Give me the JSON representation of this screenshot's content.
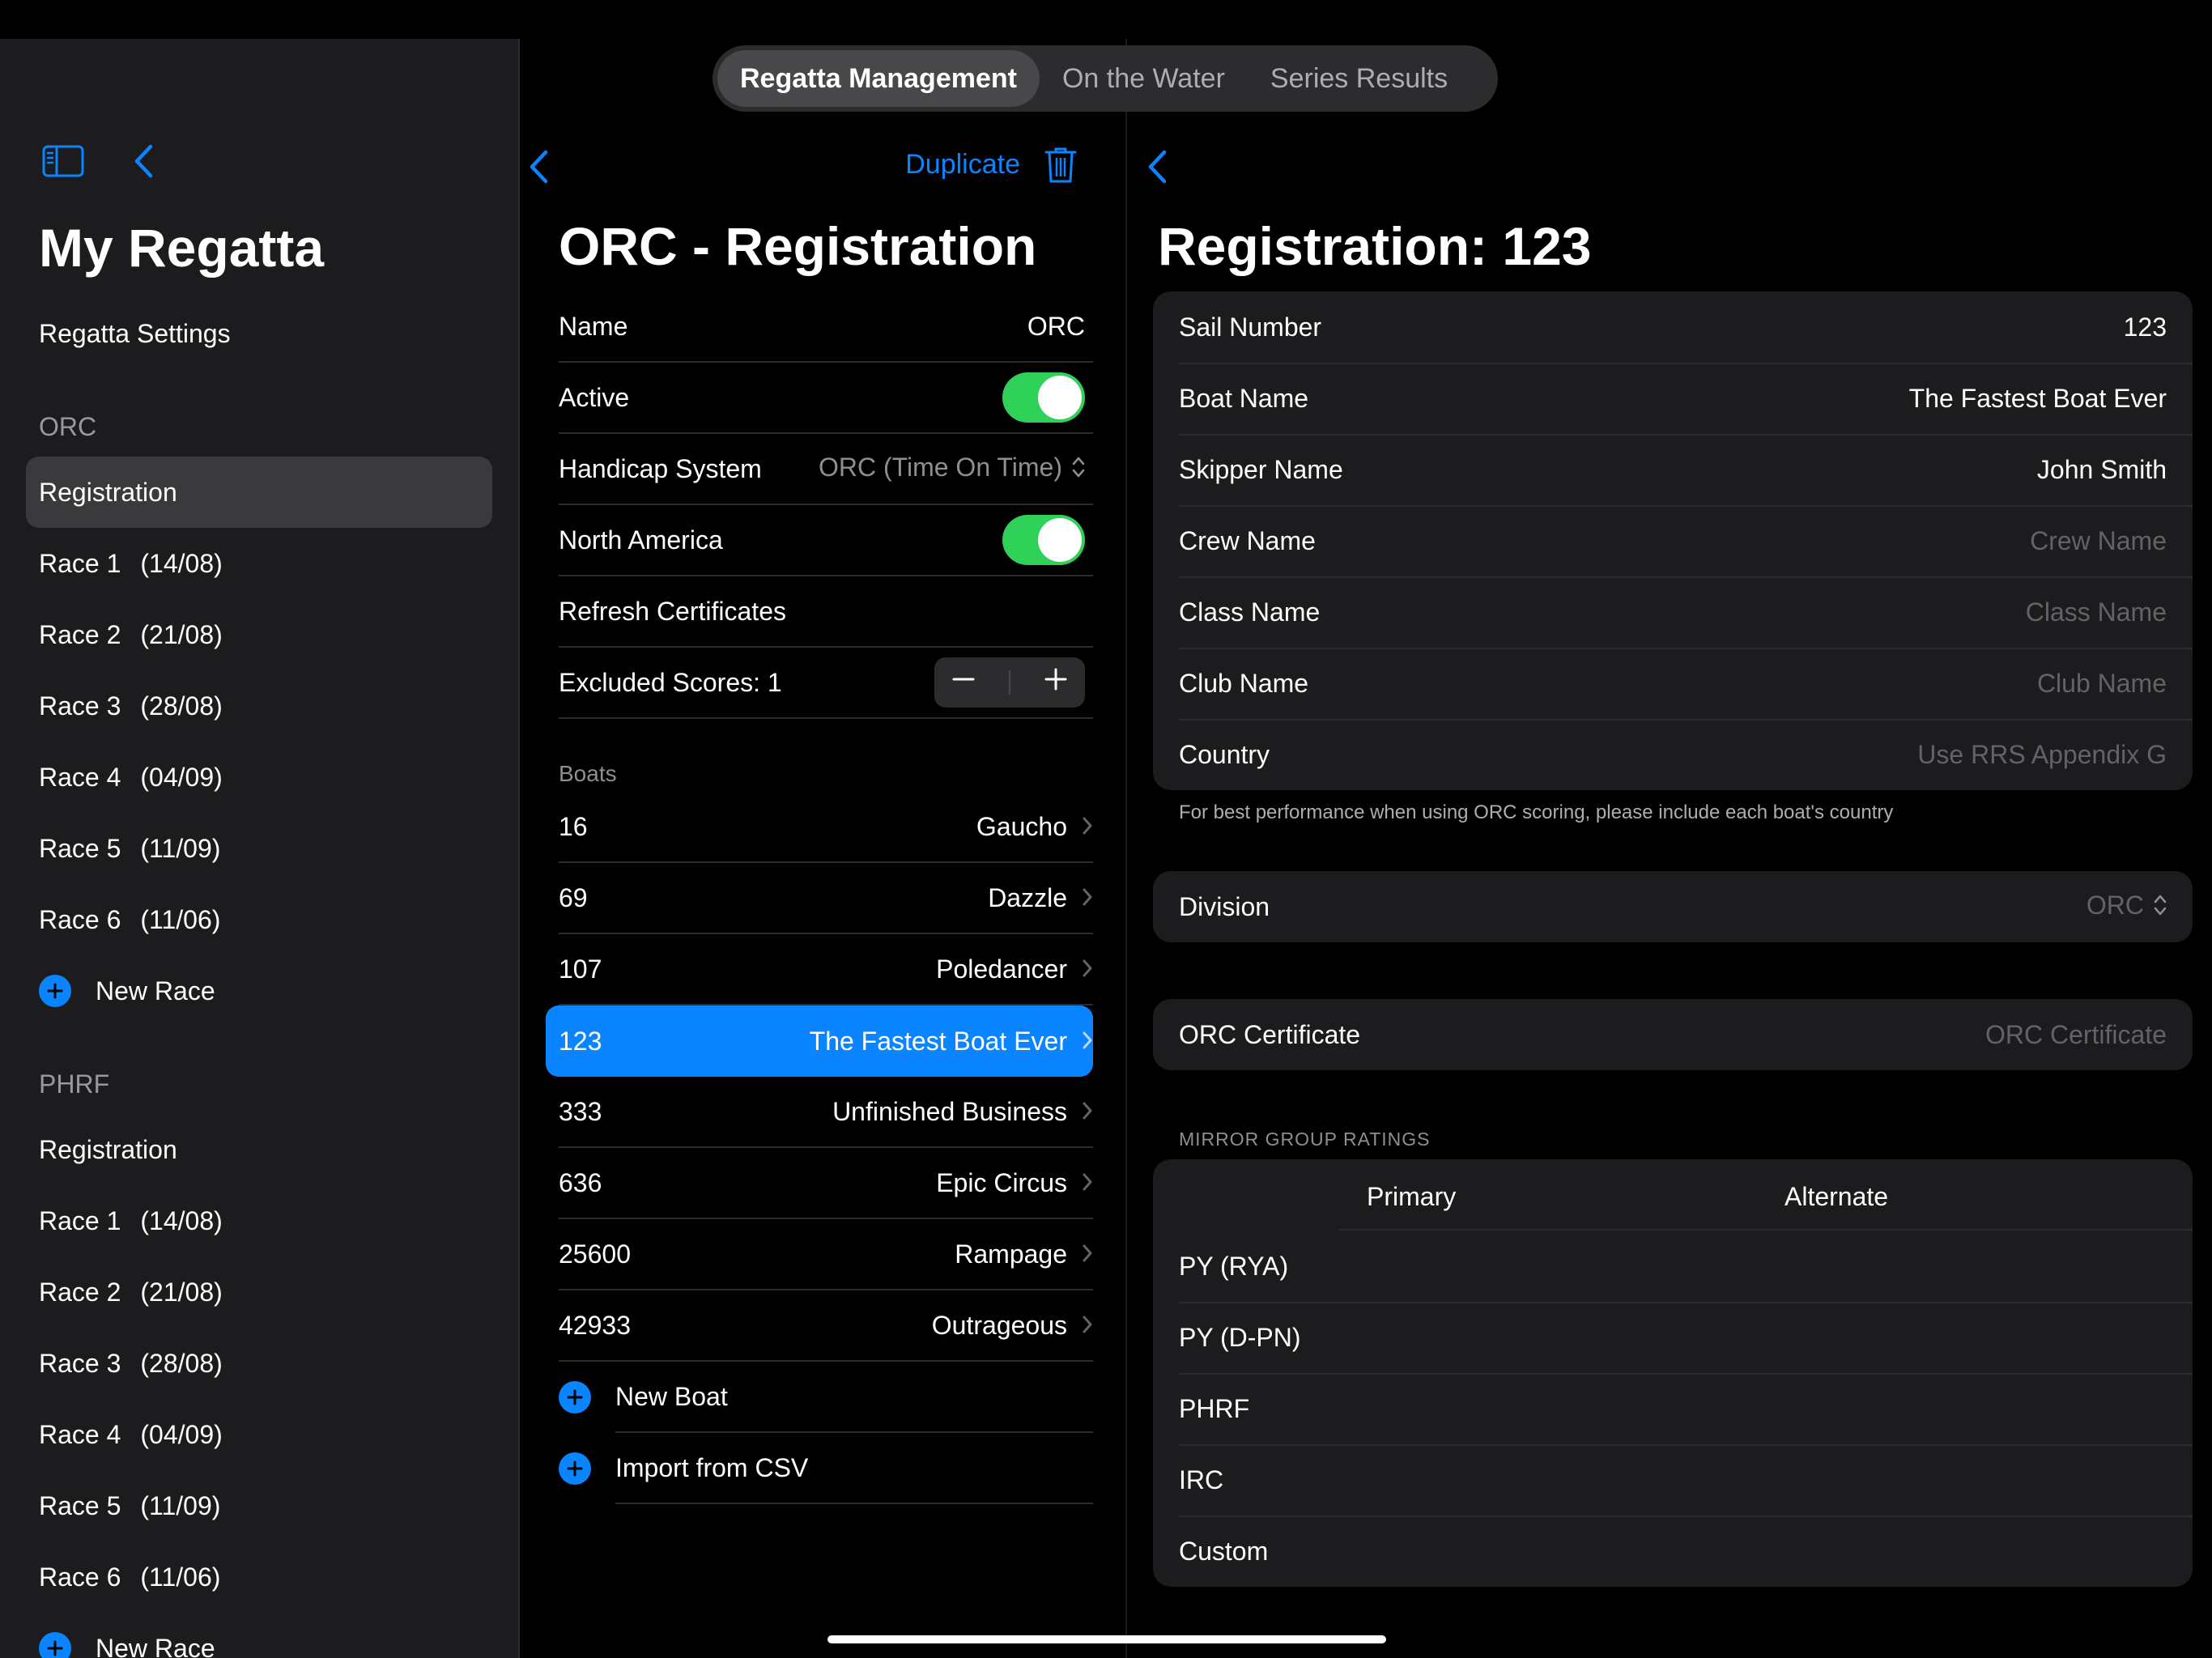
{
  "top_tabs": [
    "Regatta Management",
    "On the Water",
    "Series Results"
  ],
  "sidebar": {
    "title": "My Regatta",
    "settings_label": "Regatta Settings",
    "sections": [
      {
        "name": "ORC",
        "items": [
          {
            "label": "Registration",
            "date": ""
          },
          {
            "label": "Race 1",
            "date": "(14/08)"
          },
          {
            "label": "Race 2",
            "date": "(21/08)"
          },
          {
            "label": "Race 3",
            "date": "(28/08)"
          },
          {
            "label": "Race 4",
            "date": "(04/09)"
          },
          {
            "label": "Race 5",
            "date": "(11/09)"
          },
          {
            "label": "Race 6",
            "date": "(11/06)"
          }
        ],
        "new_label": "New Race"
      },
      {
        "name": "PHRF",
        "items": [
          {
            "label": "Registration",
            "date": ""
          },
          {
            "label": "Race 1",
            "date": "(14/08)"
          },
          {
            "label": "Race 2",
            "date": "(21/08)"
          },
          {
            "label": "Race 3",
            "date": "(28/08)"
          },
          {
            "label": "Race 4",
            "date": "(04/09)"
          },
          {
            "label": "Race 5",
            "date": "(11/09)"
          },
          {
            "label": "Race 6",
            "date": "(11/06)"
          }
        ],
        "new_label": "New Race"
      }
    ]
  },
  "middle": {
    "duplicate_label": "Duplicate",
    "title": "ORC - Registration",
    "name_label": "Name",
    "name_value": "ORC",
    "active_label": "Active",
    "active_on": true,
    "handicap_label": "Handicap System",
    "handicap_value": "ORC (Time On Time)",
    "north_america_label": "North America",
    "north_america_on": true,
    "refresh_label": "Refresh Certificates",
    "excluded_label": "Excluded Scores: 1",
    "boats_header": "Boats",
    "boats": [
      {
        "sail": "16",
        "name": "Gaucho"
      },
      {
        "sail": "69",
        "name": "Dazzle"
      },
      {
        "sail": "107",
        "name": "Poledancer"
      },
      {
        "sail": "123",
        "name": "The Fastest Boat Ever"
      },
      {
        "sail": "333",
        "name": "Unfinished Business"
      },
      {
        "sail": "636",
        "name": "Epic Circus"
      },
      {
        "sail": "25600",
        "name": "Rampage"
      },
      {
        "sail": "42933",
        "name": "Outrageous"
      }
    ],
    "new_boat_label": "New Boat",
    "import_label": "Import from CSV"
  },
  "detail": {
    "title": "Registration: 123",
    "fields": [
      {
        "label": "Sail Number",
        "value": "123",
        "placeholder": ""
      },
      {
        "label": "Boat Name",
        "value": "The Fastest Boat Ever",
        "placeholder": ""
      },
      {
        "label": "Skipper Name",
        "value": "John Smith",
        "placeholder": ""
      },
      {
        "label": "Crew Name",
        "value": "",
        "placeholder": "Crew Name"
      },
      {
        "label": "Class Name",
        "value": "",
        "placeholder": "Class Name"
      },
      {
        "label": "Club Name",
        "value": "",
        "placeholder": "Club Name"
      },
      {
        "label": "Country",
        "value": "",
        "placeholder": "Use RRS Appendix G"
      }
    ],
    "footnote": "For best performance when using ORC scoring, please include each boat's country",
    "division_label": "Division",
    "division_value": "ORC",
    "certificate_label": "ORC Certificate",
    "certificate_placeholder": "ORC Certificate",
    "ratings_caption": "MIRROR GROUP RATINGS",
    "ratings_primary": "Primary",
    "ratings_alternate": "Alternate",
    "ratings_rows": [
      "PY (RYA)",
      "PY (D-PN)",
      "PHRF",
      "IRC",
      "Custom"
    ]
  },
  "colors": {
    "accent": "#0a84ff",
    "toggle_on": "#30d158",
    "panel": "#1c1c1e"
  }
}
